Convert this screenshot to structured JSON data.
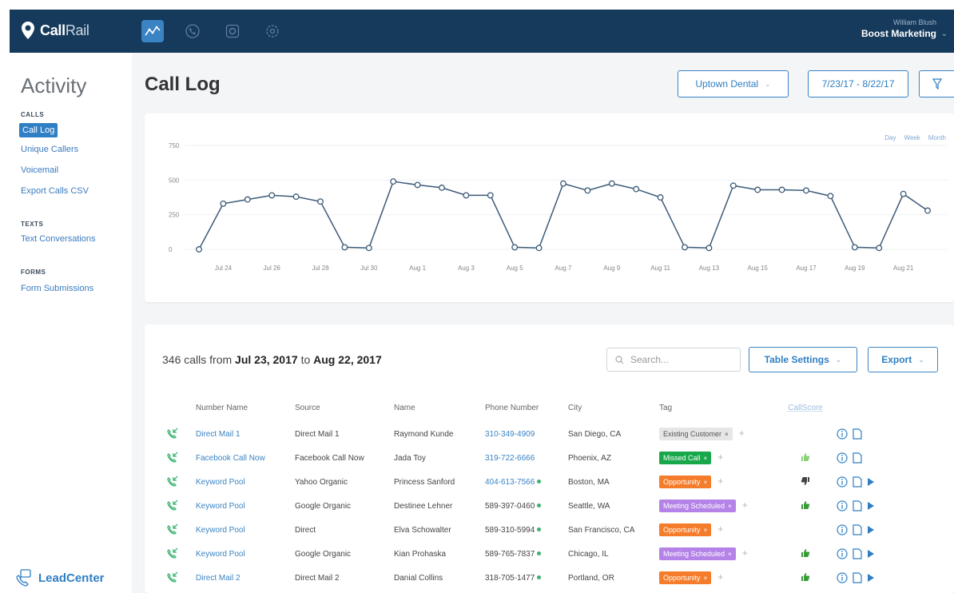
{
  "app": {
    "brand_bold": "Call",
    "brand_light": "Rail"
  },
  "account": {
    "user": "William Blush",
    "company": "Boost Marketing"
  },
  "sidebar": {
    "title": "Activity",
    "sections": [
      {
        "label": "CALLS",
        "items": [
          {
            "label": "Call Log",
            "active": true
          },
          {
            "label": "Unique Callers"
          },
          {
            "label": "Voicemail"
          },
          {
            "label": "Export Calls CSV"
          }
        ]
      },
      {
        "label": "TEXTS",
        "items": [
          {
            "label": "Text Conversations"
          }
        ]
      },
      {
        "label": "FORMS",
        "items": [
          {
            "label": "Form Submissions"
          }
        ]
      }
    ],
    "footer_brand": "LeadCenter"
  },
  "header": {
    "title": "Call Log",
    "company_select": "Uptown Dental",
    "date_range": "7/23/17 - 8/22/17"
  },
  "chart_data": {
    "type": "line",
    "title": "",
    "range_links": [
      "Day",
      "Week",
      "Month"
    ],
    "y_ticks": [
      0,
      250,
      500,
      750
    ],
    "ylim": [
      0,
      750
    ],
    "x_tick_labels": [
      "Jul 24",
      "Jul 26",
      "Jul 28",
      "Jul 30",
      "Aug 1",
      "Aug 3",
      "Aug 5",
      "Aug 7",
      "Aug 9",
      "Aug 11",
      "Aug 13",
      "Aug 15",
      "Aug 17",
      "Aug 19",
      "Aug 21"
    ],
    "x": [
      "Jul 23",
      "Jul 24",
      "Jul 25",
      "Jul 26",
      "Jul 27",
      "Jul 28",
      "Jul 29",
      "Jul 30",
      "Jul 31",
      "Aug 1",
      "Aug 2",
      "Aug 3",
      "Aug 4",
      "Aug 5",
      "Aug 6",
      "Aug 7",
      "Aug 8",
      "Aug 9",
      "Aug 10",
      "Aug 11",
      "Aug 12",
      "Aug 13",
      "Aug 14",
      "Aug 15",
      "Aug 16",
      "Aug 17",
      "Aug 18",
      "Aug 19",
      "Aug 20",
      "Aug 21",
      "Aug 22"
    ],
    "values": [
      0,
      330,
      360,
      390,
      380,
      345,
      15,
      10,
      490,
      465,
      445,
      390,
      390,
      15,
      10,
      475,
      425,
      475,
      435,
      375,
      15,
      10,
      460,
      430,
      430,
      425,
      385,
      15,
      10,
      400,
      280
    ],
    "color": "#3c5a78"
  },
  "table": {
    "summary_count": "346 calls from",
    "summary_start": "Jul 23, 2017",
    "summary_to": "to",
    "summary_end": "Aug 22, 2017",
    "search_placeholder": "Search...",
    "settings_label": "Table Settings",
    "export_label": "Export",
    "columns": [
      "Number Name",
      "Source",
      "Name",
      "Phone Number",
      "City",
      "Tag",
      "CallScore"
    ],
    "rows": [
      {
        "number_name": "Direct Mail 1",
        "source": "Direct Mail 1",
        "name": "Raymond Kunde",
        "phone": "310-349-4909",
        "phone_linked": true,
        "city": "San Diego, CA",
        "tag": "Existing Customer",
        "tag_color": "#e6e6e6",
        "tag_text_color": "#555",
        "score": "",
        "play": false
      },
      {
        "number_name": "Facebook Call Now",
        "source": "Facebook Call Now",
        "name": "Jada Toy",
        "phone": "319-722-6666",
        "phone_linked": true,
        "city": "Phoenix, AZ",
        "tag": "Missed Call",
        "tag_color": "#18a84a",
        "tag_text_color": "#fff",
        "score": "up-light",
        "play": false
      },
      {
        "number_name": "Keyword Pool",
        "source": "Yahoo Organic",
        "name": "Princess Sanford",
        "phone": "404-613-7566",
        "phone_linked": true,
        "city": "Boston, MA",
        "tag": "Opportunity",
        "tag_color": "#f47c2b",
        "tag_text_color": "#fff",
        "score": "down",
        "play": true
      },
      {
        "number_name": "Keyword Pool",
        "source": "Google Organic",
        "name": "Destinee Lehner",
        "phone": "589-397-0460",
        "phone_linked": false,
        "city": "Seattle, WA",
        "tag": "Meeting Scheduled",
        "tag_color": "#b583e8",
        "tag_text_color": "#fff",
        "score": "up",
        "play": true
      },
      {
        "number_name": "Keyword Pool",
        "source": "Direct",
        "name": "Elva Schowalter",
        "phone": "589-310-5994",
        "phone_linked": false,
        "city": "San Francisco, CA",
        "tag": "Opportunity",
        "tag_color": "#f47c2b",
        "tag_text_color": "#fff",
        "score": "",
        "play": true
      },
      {
        "number_name": "Keyword Pool",
        "source": "Google Organic",
        "name": "Kian Prohaska",
        "phone": "589-765-7837",
        "phone_linked": false,
        "city": "Chicago, IL",
        "tag": "Meeting Scheduled",
        "tag_color": "#b583e8",
        "tag_text_color": "#fff",
        "score": "up",
        "play": true
      },
      {
        "number_name": "Direct Mail 2",
        "source": "Direct Mail 2",
        "name": "Danial Collins",
        "phone": "318-705-1477",
        "phone_linked": false,
        "city": "Portland, OR",
        "tag": "Opportunity",
        "tag_color": "#f47c2b",
        "tag_text_color": "#fff",
        "score": "up",
        "play": true
      }
    ]
  }
}
